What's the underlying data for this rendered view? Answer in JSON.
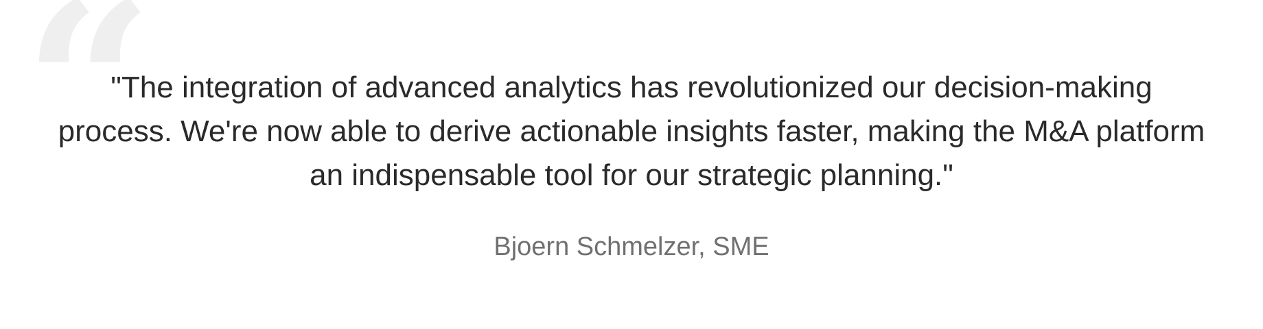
{
  "testimonial": {
    "quote_mark": "“",
    "quote": "\"The integration of advanced analytics has revolutionized our decision-making process. We're now able to derive actionable insights faster, making the M&A platform an indispensable tool for our strategic planning.\"",
    "author": "Bjoern Schmelzer, SME"
  },
  "colors": {
    "background": "#ffffff",
    "quote_text": "#2a2a2a",
    "author_text": "#707070",
    "quote_mark": "#efefef"
  },
  "icons": {
    "quote_mark": "quote-icon"
  }
}
